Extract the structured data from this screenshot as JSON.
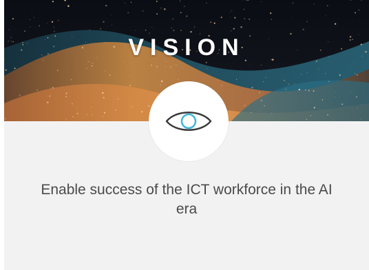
{
  "card": {
    "title": "VISION",
    "statement": "Enable success of the ICT workforce in the AI era",
    "icon": "eye-icon",
    "colors": {
      "card_background": "#f2f2f2",
      "title_text": "#ffffff",
      "statement_text": "#4a4a4a",
      "icon_stroke": "#3a3a3a",
      "icon_iris": "#3fb6d6",
      "banner_dark": "#0d1017",
      "banner_orange": "#e08a3c",
      "banner_teal": "#3a8fa8"
    }
  }
}
